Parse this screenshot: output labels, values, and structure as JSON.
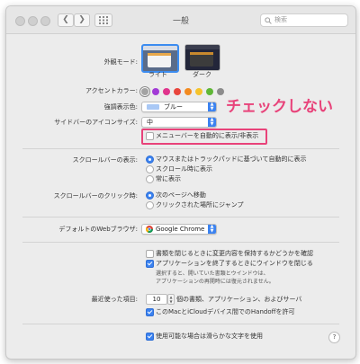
{
  "window": {
    "title": "一般",
    "search_placeholder": "検索"
  },
  "appearance": {
    "label": "外観モード:",
    "options": [
      {
        "label": "ライト",
        "selected": true
      },
      {
        "label": "ダーク",
        "selected": false
      }
    ]
  },
  "accent": {
    "label": "アクセントカラー:",
    "colors": [
      "#a3a3a3",
      "#a23bd6",
      "#e0348c",
      "#e8453c",
      "#f28a1f",
      "#f5c32c",
      "#5fb736",
      "#8c8c8c"
    ]
  },
  "highlight_color": {
    "label": "強調表示色:",
    "value": "ブルー",
    "swatch": "#a9c8f5"
  },
  "sidebar_icon": {
    "label": "サイドバーのアイコンサイズ:",
    "value": "中"
  },
  "menubar": {
    "label": "メニューバーを自動的に表示/非表示",
    "checked": false
  },
  "annotation": "チェックしない",
  "scrollbars": {
    "label": "スクロールバーの表示:",
    "options": [
      {
        "label": "マウスまたはトラックパッドに基づいて自動的に表示",
        "selected": true
      },
      {
        "label": "スクロール時に表示",
        "selected": false
      },
      {
        "label": "常に表示",
        "selected": false
      }
    ]
  },
  "scroll_click": {
    "label": "スクロールバーのクリック時:",
    "options": [
      {
        "label": "次のページへ移動",
        "selected": true
      },
      {
        "label": "クリックされた場所にジャンプ",
        "selected": false
      }
    ]
  },
  "browser": {
    "label": "デフォルトのWebブラウザ:",
    "value": "Google Chrome"
  },
  "documents": {
    "ask_keep": {
      "label": "書類を閉じるときに変更内容を保持するかどうかを確認",
      "checked": false
    },
    "close_windows": {
      "label": "アプリケーションを終了するときにウインドウを閉じる",
      "checked": true
    },
    "note_line1": "選択すると、開いていた書類とウインドウは、",
    "note_line2": "アプリケーションの再開時には復元されません。"
  },
  "recent": {
    "label": "最近使った項目:",
    "count": "10",
    "suffix": "個の書類、アプリケーション、およびサーバ"
  },
  "handoff": {
    "label": "このMacとiCloudデバイス間でのHandoffを許可",
    "checked": true
  },
  "smoothing": {
    "label": "使用可能な場合は滑らかな文字を使用",
    "checked": true
  },
  "help_label": "?"
}
